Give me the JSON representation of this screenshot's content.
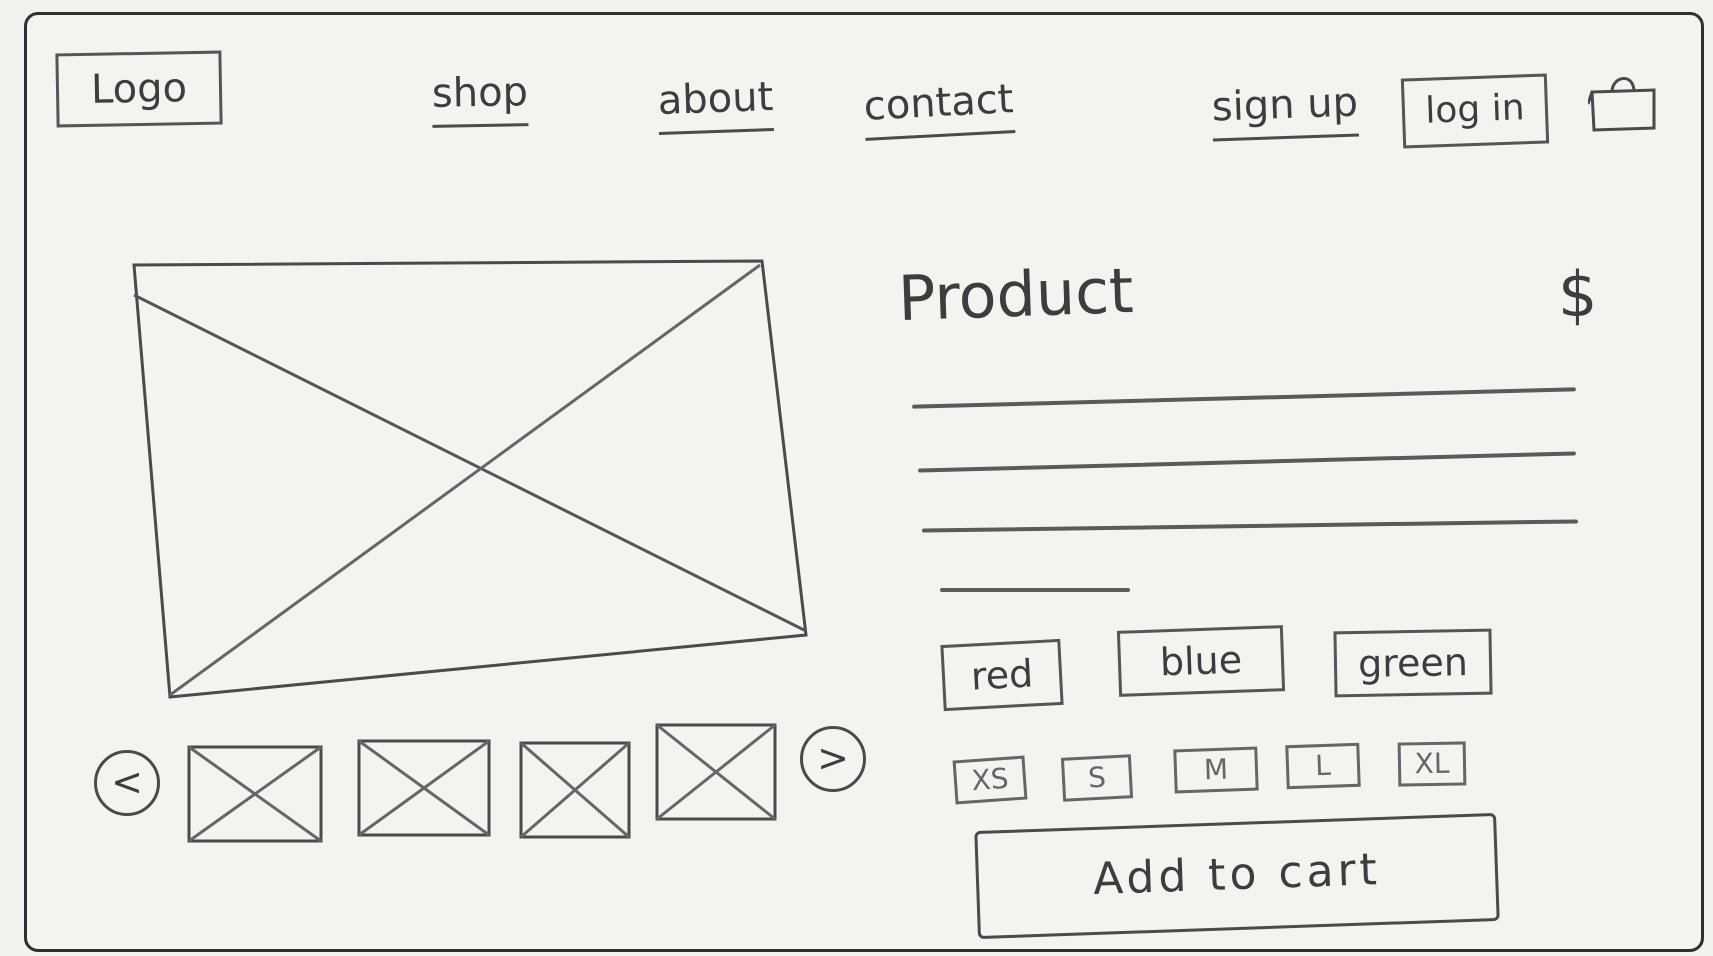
{
  "header": {
    "logo": "Logo",
    "nav": [
      {
        "label": "shop"
      },
      {
        "label": "about"
      },
      {
        "label": "contact"
      }
    ],
    "sign_up": "sign up",
    "log_in": "log in",
    "cart_icon": "shopping-bag-icon"
  },
  "gallery": {
    "prev_symbol": "<",
    "next_symbol": ">",
    "thumbnail_count": 4
  },
  "product": {
    "title": "Product",
    "price": "$",
    "colors": [
      "red",
      "blue",
      "green"
    ],
    "sizes": [
      "XS",
      "S",
      "M",
      "L",
      "XL"
    ],
    "add_to_cart": "Add to cart"
  }
}
